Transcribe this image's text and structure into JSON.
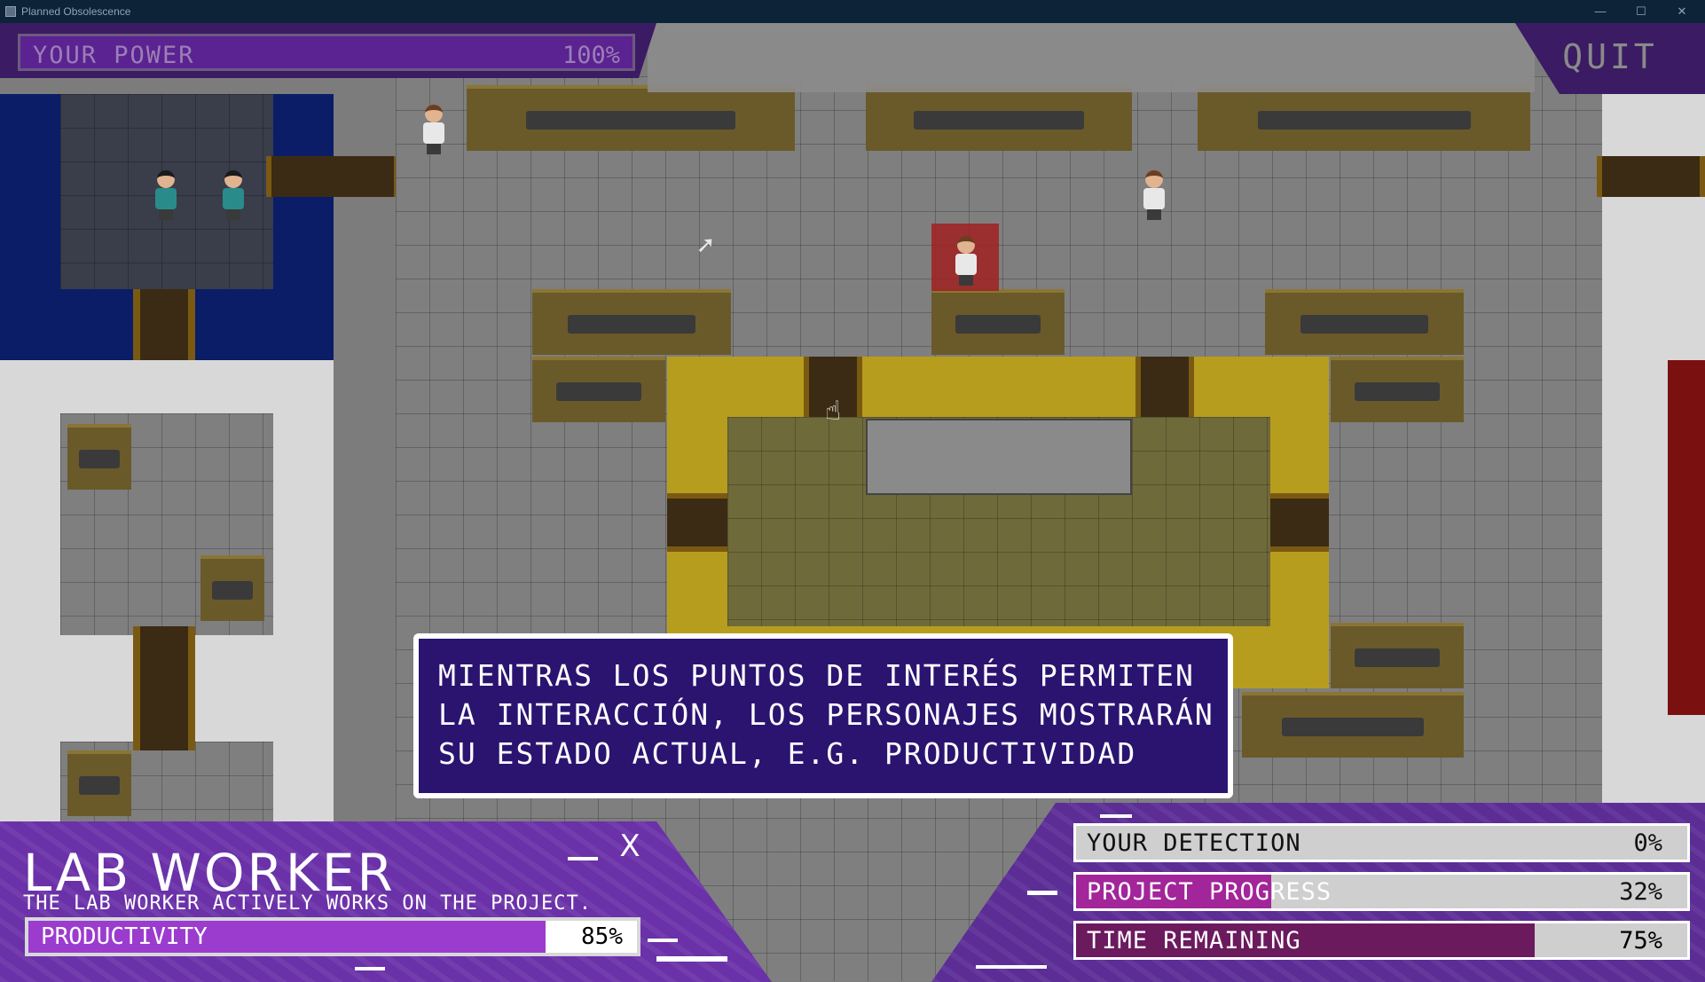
{
  "window": {
    "title": "Planned Obsolescence"
  },
  "hud": {
    "power": {
      "label": "YOUR POWER",
      "value": "100%",
      "fraction": 1.0
    },
    "quit_label": "QUIT"
  },
  "tutorial": {
    "lines": [
      "MIENTRAS LOS PUNTOS DE INTERÉS PERMITEN",
      "LA INTERACCIÓN, LOS PERSONAJES MOSTRARÁN",
      "SU ESTADO ACTUAL, E.G. PRODUCTIVIDAD"
    ]
  },
  "character_panel": {
    "title": "LAB WORKER",
    "description": "THE LAB WORKER ACTIVELY WORKS ON THE PROJECT.",
    "close_label": "X",
    "productivity": {
      "label": "PRODUCTIVITY",
      "value": "85%",
      "fraction": 0.85
    }
  },
  "stats": [
    {
      "label": "YOUR DETECTION",
      "value": "0%",
      "fraction": 0.0
    },
    {
      "label": "PROJECT PROGRESS",
      "value": "32%",
      "fraction": 0.32
    },
    {
      "label": "TIME REMAINING",
      "value": "75%",
      "fraction": 0.75
    }
  ],
  "colors": {
    "hud_purple": "#6a31a8",
    "dialog_bg": "#2a1470",
    "progress_fill": "#a2259a",
    "selected_tile": "#a02020"
  }
}
